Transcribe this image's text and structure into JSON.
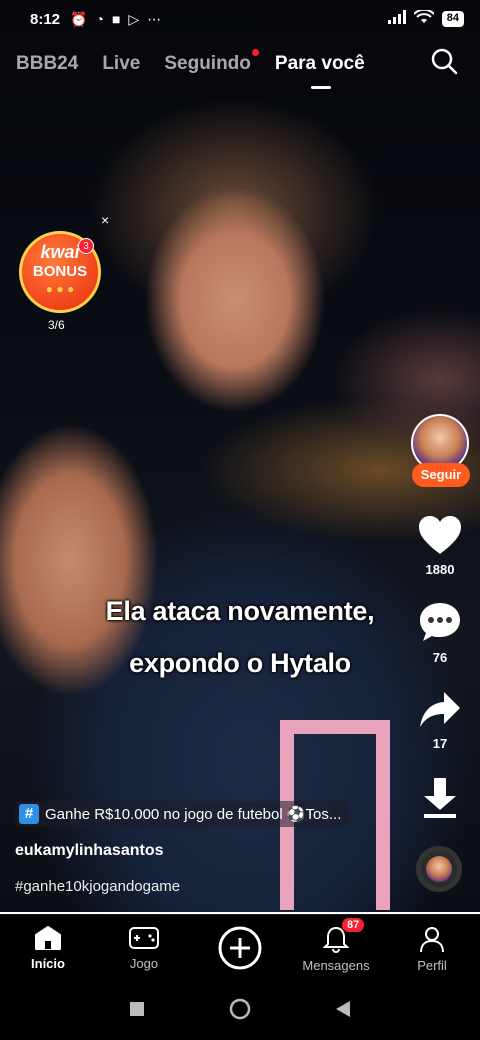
{
  "status_bar": {
    "time": "8:12",
    "dots": "⋯",
    "battery": "84"
  },
  "top_tabs": [
    {
      "label": "BBB24"
    },
    {
      "label": "Live"
    },
    {
      "label": "Seguindo"
    },
    {
      "label": "Para você"
    }
  ],
  "bonus": {
    "brand": "kwai",
    "label": "BONUS",
    "badge": "3",
    "progress": "3/6",
    "close": "×"
  },
  "creator": {
    "follow_label": "Seguir",
    "username": "eukamylinhasantos",
    "hashtag": "#ganhe10kjogandogame"
  },
  "actions": {
    "likes": "1880",
    "comments": "76",
    "shares": "17"
  },
  "captions": {
    "line1": "Ela ataca novamente,",
    "line2": "expondo o Hytalo"
  },
  "promo": {
    "hash": "#",
    "text": "Ganhe R$10.000 no jogo de futebol ⚽Tos..."
  },
  "video_progress": 1.0,
  "bottom_nav": {
    "home": "Início",
    "game": "Jogo",
    "messages": "Mensagens",
    "messages_badge": "87",
    "profile": "Perfil"
  },
  "colors": {
    "accent": "#ff5a1f",
    "badge": "#ff1d2f",
    "promo_hash": "#2e8fe6"
  }
}
